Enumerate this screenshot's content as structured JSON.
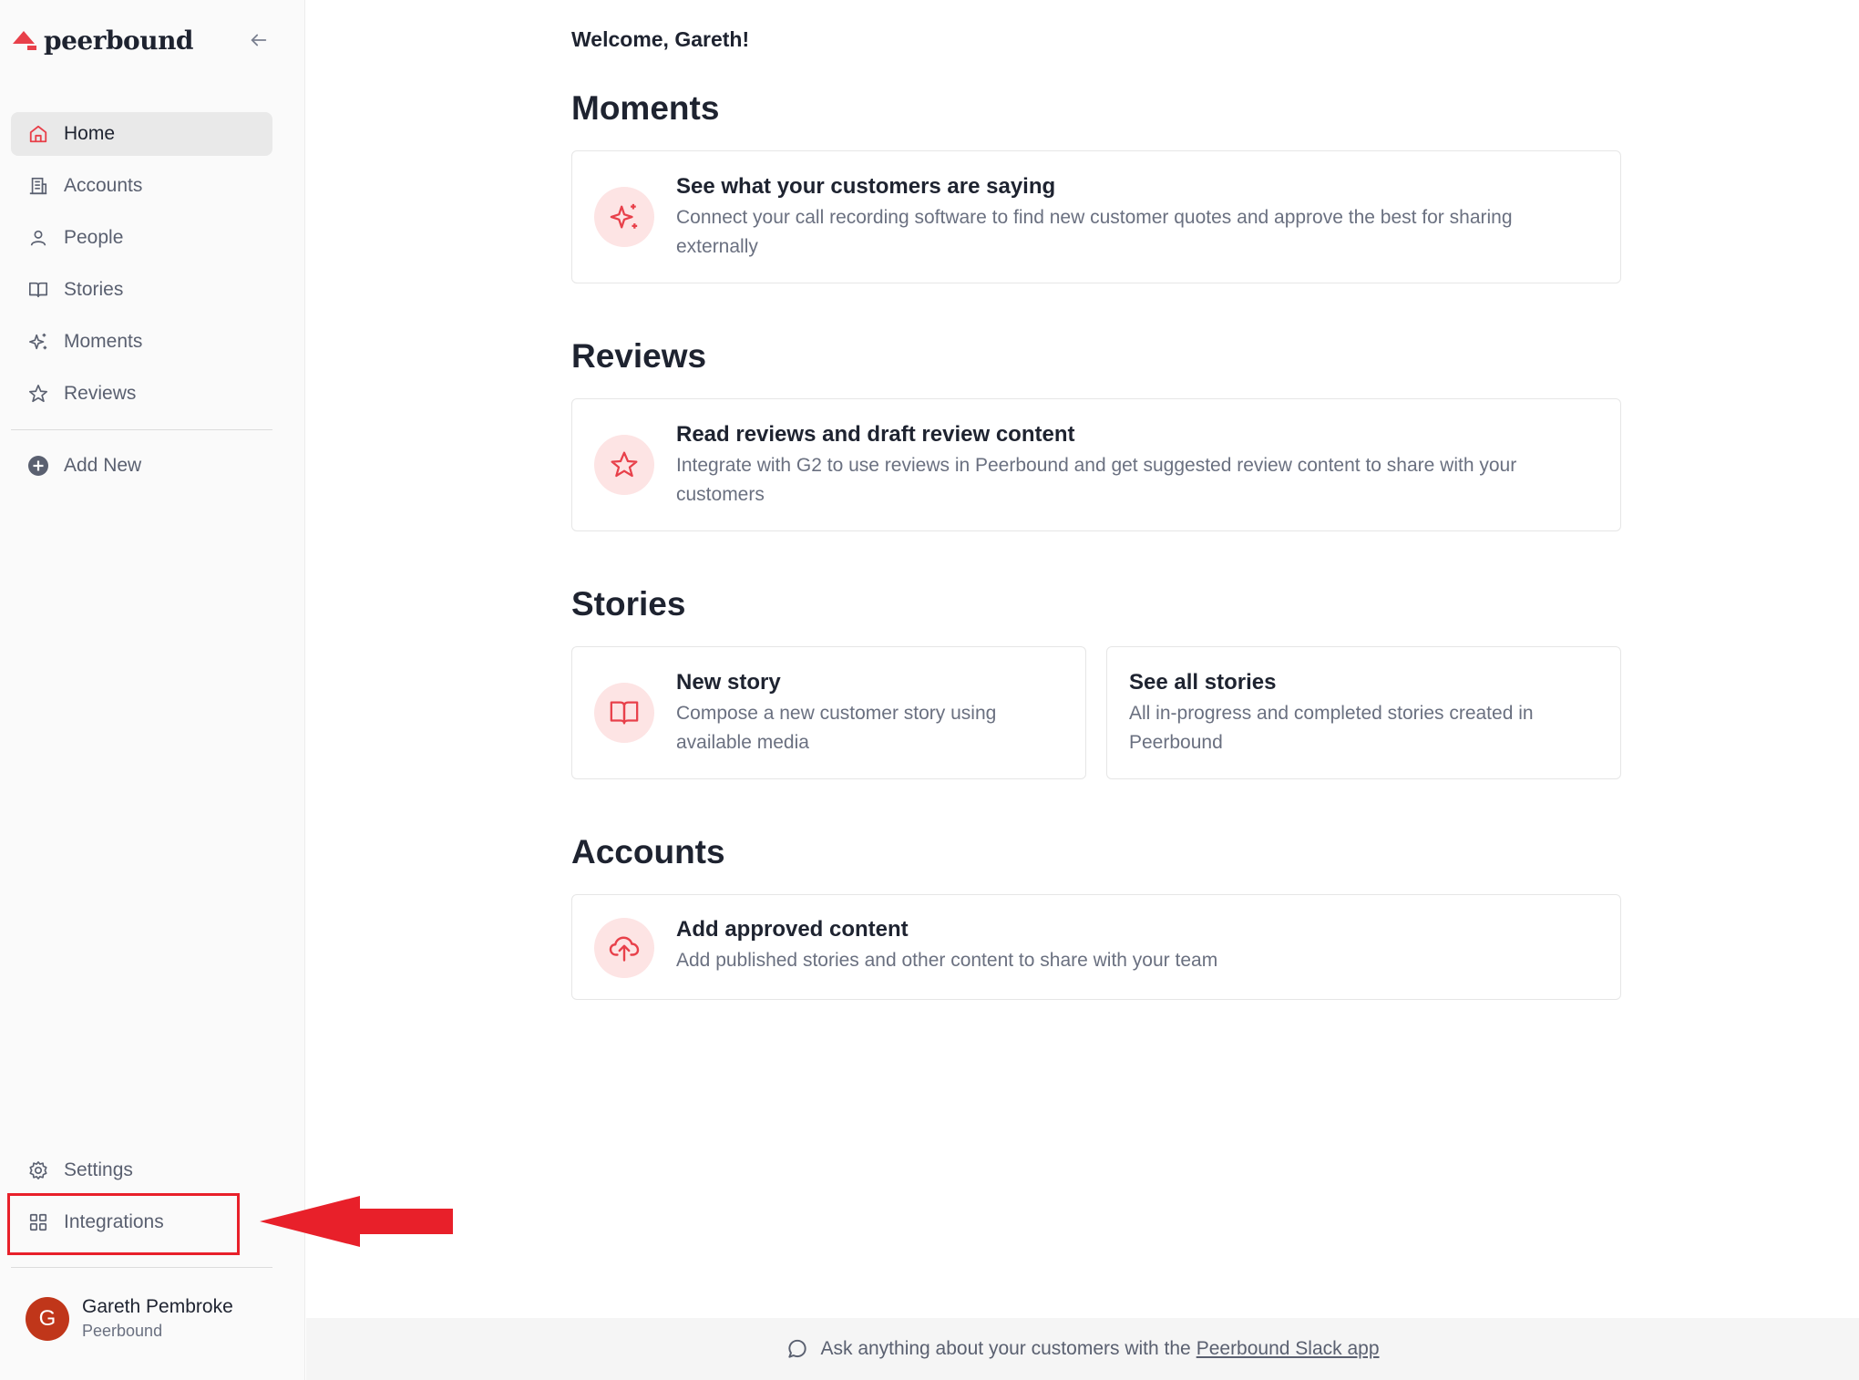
{
  "brand": {
    "name": "peerbound",
    "accent": "#e8404a"
  },
  "sidebar": {
    "items": [
      {
        "label": "Home",
        "icon": "home-icon",
        "active": true
      },
      {
        "label": "Accounts",
        "icon": "building-icon"
      },
      {
        "label": "People",
        "icon": "person-icon"
      },
      {
        "label": "Stories",
        "icon": "book-icon"
      },
      {
        "label": "Moments",
        "icon": "sparkles-icon"
      },
      {
        "label": "Reviews",
        "icon": "star-icon"
      }
    ],
    "add_new": "Add New",
    "settings": "Settings",
    "integrations": "Integrations"
  },
  "user": {
    "initial": "G",
    "name": "Gareth Pembroke",
    "org": "Peerbound"
  },
  "main": {
    "welcome": "Welcome, Gareth!",
    "moments": {
      "title": "Moments",
      "card": {
        "title": "See what your customers are saying",
        "desc": "Connect your call recording software to find new customer quotes and approve the best for sharing externally"
      }
    },
    "reviews": {
      "title": "Reviews",
      "card": {
        "title": "Read reviews and draft review content",
        "desc": "Integrate with G2 to use reviews in Peerbound and get suggested review content to share with your customers"
      }
    },
    "stories": {
      "title": "Stories",
      "new": {
        "title": "New story",
        "desc": "Compose a new customer story using available media"
      },
      "all": {
        "title": "See all stories",
        "desc": "All in-progress and completed stories created in Peerbound"
      }
    },
    "accounts": {
      "title": "Accounts",
      "card": {
        "title": "Add approved content",
        "desc": "Add published stories and other content to share with your team"
      }
    }
  },
  "footer": {
    "text": "Ask anything about your customers with the",
    "link": "Peerbound Slack app"
  }
}
